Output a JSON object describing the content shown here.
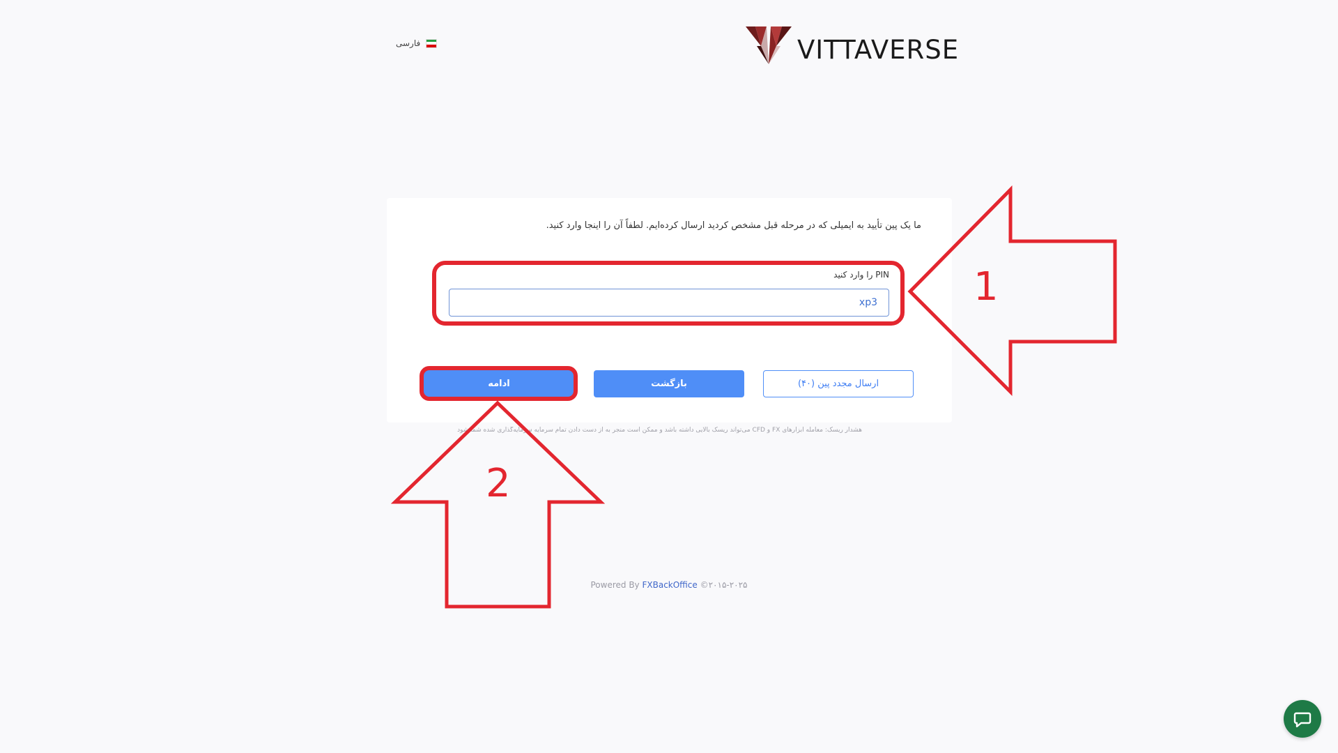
{
  "header": {
    "language_label": "فارسی",
    "brand_name": "VITTAVERSE"
  },
  "verify": {
    "intro": "ما یک پین تأیید به ایمیلی که در مرحله قبل مشخص کردید ارسال کرده‌ایم. لطفاً آن را اینجا وارد کنید.",
    "pin_label": "PIN را وارد کنید",
    "pin_value": "xp3"
  },
  "buttons": {
    "continue": "ادامه",
    "back": "بازگشت",
    "resend": "ارسال مجدد پین (۴۰)"
  },
  "risk_warning": "هشدار ریسک: معامله ابزارهای FX و CFD می‌تواند ریسک بالایی داشته باشد و ممکن است منجر به از دست دادن تمام سرمایه سرمایه‌گذاری شده شما شود",
  "footer": {
    "powered_by": "Powered By",
    "provider": "FXBackOffice",
    "years": "©۲۰۱۵-۲۰۲۵"
  },
  "annotations": {
    "step1": "1",
    "step2": "2",
    "color": "#e3262f"
  },
  "colors": {
    "primary": "#4f8ef7",
    "annotation": "#e3262f",
    "chat": "#1e7a46"
  },
  "icons": {
    "flag": "iran-flag-icon",
    "chat": "chat-bubble-icon"
  }
}
